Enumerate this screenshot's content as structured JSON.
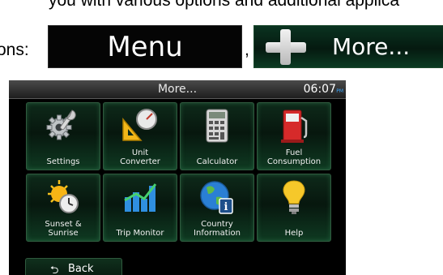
{
  "document": {
    "line1": "you with various options and additional applica",
    "line2": "ons:",
    "separator": ","
  },
  "samples": {
    "menu_label": "Menu",
    "more_label": "More...",
    "more_icon": "plus-icon"
  },
  "screen": {
    "title": "More...",
    "clock": "06:07",
    "clock_ampm": "PM",
    "back_label": "Back",
    "back_icon": "back-arrow-icon",
    "tiles": [
      {
        "label": "Settings",
        "icon": "settings-icon"
      },
      {
        "label": "Unit\nConverter",
        "icon": "unit-converter-icon"
      },
      {
        "label": "Calculator",
        "icon": "calculator-icon"
      },
      {
        "label": "Fuel\nConsumption",
        "icon": "fuel-pump-icon"
      },
      {
        "label": "Sunset &\nSunrise",
        "icon": "sun-clock-icon"
      },
      {
        "label": "Trip Monitor",
        "icon": "trip-monitor-icon"
      },
      {
        "label": "Country\nInformation",
        "icon": "globe-info-icon"
      },
      {
        "label": "Help",
        "icon": "lightbulb-icon"
      }
    ]
  },
  "colors": {
    "tile_bg": "#0e2a1a",
    "tile_border": "#2f5a3e",
    "accent_blue": "#3aa8ff"
  }
}
